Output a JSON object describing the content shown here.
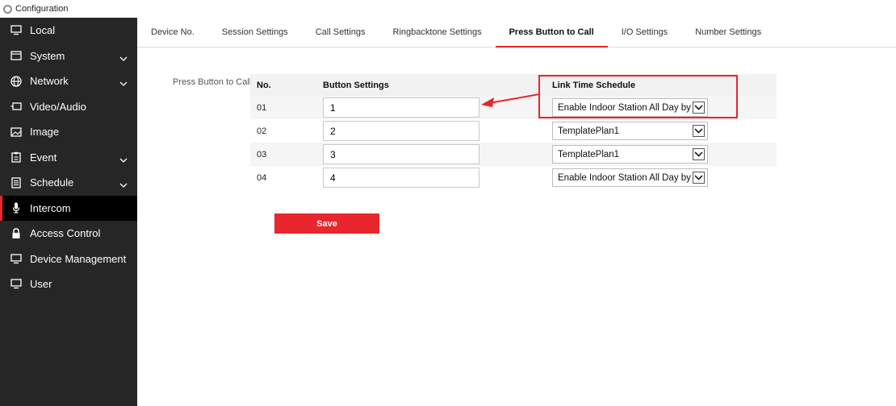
{
  "window": {
    "title": "Configuration"
  },
  "sidebar": {
    "items": [
      {
        "label": "Local",
        "icon": "monitor-icon",
        "expandable": false,
        "active": false
      },
      {
        "label": "System",
        "icon": "system-icon",
        "expandable": true,
        "active": false
      },
      {
        "label": "Network",
        "icon": "globe-icon",
        "expandable": true,
        "active": false
      },
      {
        "label": "Video/Audio",
        "icon": "video-icon",
        "expandable": false,
        "active": false
      },
      {
        "label": "Image",
        "icon": "image-icon",
        "expandable": false,
        "active": false
      },
      {
        "label": "Event",
        "icon": "event-icon",
        "expandable": true,
        "active": false
      },
      {
        "label": "Schedule",
        "icon": "schedule-icon",
        "expandable": true,
        "active": false
      },
      {
        "label": "Intercom",
        "icon": "microphone-icon",
        "expandable": false,
        "active": true
      },
      {
        "label": "Access Control",
        "icon": "lock-icon",
        "expandable": false,
        "active": false
      },
      {
        "label": "Device Management",
        "icon": "monitor-icon",
        "expandable": false,
        "active": false
      },
      {
        "label": "User",
        "icon": "monitor-icon",
        "expandable": false,
        "active": false
      }
    ]
  },
  "tabs": [
    {
      "label": "Device No.",
      "active": false
    },
    {
      "label": "Session Settings",
      "active": false
    },
    {
      "label": "Call Settings",
      "active": false
    },
    {
      "label": "Ringbacktone Settings",
      "active": false
    },
    {
      "label": "Press Button to Call",
      "active": true
    },
    {
      "label": "I/O Settings",
      "active": false
    },
    {
      "label": "Number Settings",
      "active": false
    }
  ],
  "content": {
    "section_label": "Press Button to Call",
    "columns": [
      "No.",
      "Button Settings",
      "Link Time Schedule"
    ],
    "rows": [
      {
        "no": "01",
        "button": "1",
        "schedule": "Enable Indoor Station All Day by Default"
      },
      {
        "no": "02",
        "button": "2",
        "schedule": "TemplatePlan1"
      },
      {
        "no": "03",
        "button": "3",
        "schedule": "TemplatePlan1"
      },
      {
        "no": "04",
        "button": "4",
        "schedule": "Enable Indoor Station All Day by Default"
      }
    ],
    "save_label": "Save"
  },
  "colors": {
    "accent": "#e8262c",
    "sidebar_bg": "#262626",
    "sidebar_active": "#000000"
  }
}
